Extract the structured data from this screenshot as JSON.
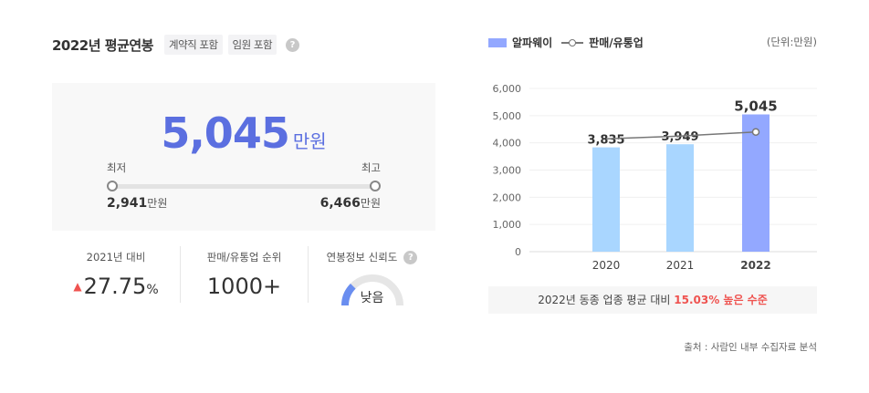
{
  "summary": {
    "title": "2022년 평균연봉",
    "tags": [
      "계약직 포함",
      "임원 포함"
    ],
    "help_glyph": "?",
    "average": "5,045",
    "average_unit": "만원",
    "min_label": "최저",
    "max_label": "최고",
    "min_value": "2,941",
    "max_value": "6,466",
    "value_unit": "만원"
  },
  "stats": {
    "growth_label": "2021년 대비",
    "growth_arrow": "▲",
    "growth_value": "27.75",
    "growth_unit": "%",
    "rank_label": "판매/유통업 순위",
    "rank_value": "1000+",
    "reliability_label": "연봉정보 신뢰도",
    "reliability_value": "낮음",
    "reliability_level": 0.25
  },
  "chart_legend": {
    "bar_series": "알파웨이",
    "line_series": "판매/유통업",
    "unit_note": "(단위:만원)"
  },
  "chart_data": {
    "type": "bar",
    "categories": [
      "2020",
      "2021",
      "2022"
    ],
    "series": [
      {
        "name": "알파웨이",
        "type": "bar",
        "values": [
          3835,
          3949,
          5045
        ],
        "labels": [
          "3,835",
          "3,949",
          "5,045"
        ]
      },
      {
        "name": "판매/유통업",
        "type": "line",
        "values": [
          4150,
          4250,
          4400
        ]
      }
    ],
    "ylim": [
      0,
      6000
    ],
    "yticks": [
      0,
      1000,
      2000,
      3000,
      4000,
      5000,
      6000
    ],
    "ytick_labels": [
      "0",
      "1,000",
      "2,000",
      "3,000",
      "4,000",
      "5,000",
      "6,000"
    ],
    "grid": true,
    "colors": {
      "bar_past": "#a9d6ff",
      "bar_current": "#93a8ff",
      "line": "#777777"
    }
  },
  "compare": {
    "prefix": "2022년 동종 업종 평균 대비",
    "highlight": "15.03% 높은 수준"
  },
  "source": "출처 : 사람인 내부 수집자료 분석"
}
